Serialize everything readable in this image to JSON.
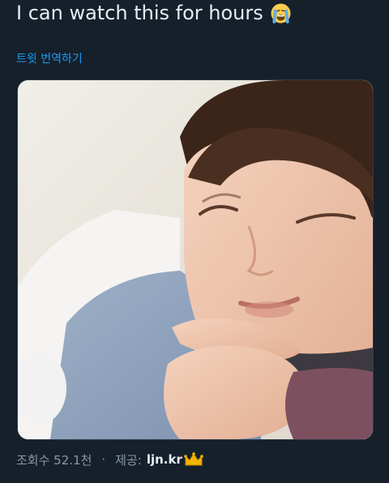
{
  "tweet": {
    "text": "I can watch this for hours",
    "emoji": "loudly-crying-face-icon"
  },
  "translate": {
    "label": "트윗 번역하기"
  },
  "media": {
    "kind": "video-thumbnail"
  },
  "meta": {
    "views": "조회수 52.1천",
    "separator": "·",
    "source_label": "제공:",
    "source_name": "ljn.kr",
    "source_icon": "crown-icon"
  },
  "colors": {
    "background": "#15202b",
    "text": "#e6edf3",
    "link": "#1d9bf0",
    "muted": "#8b98a5"
  }
}
